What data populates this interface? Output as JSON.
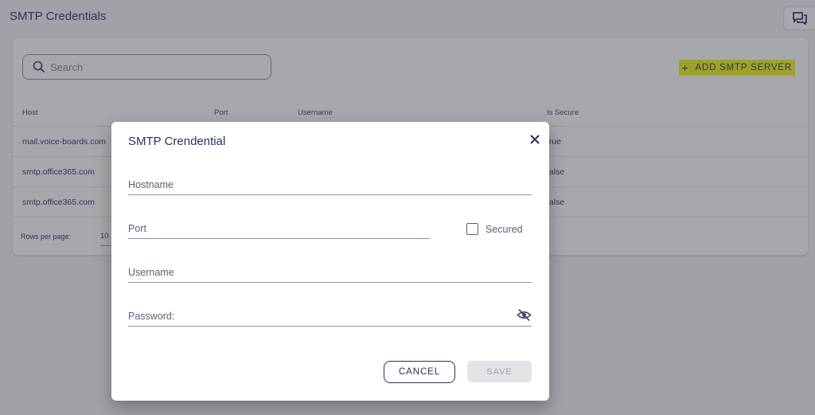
{
  "page": {
    "title": "SMTP Credentials"
  },
  "icons": {
    "chat": "chat-bubbles-icon",
    "search": "search-icon",
    "close": "close-icon",
    "password_toggle": "eye-off-icon"
  },
  "colors": {
    "primary": "#2d2f5a",
    "highlight": "#f2f20f",
    "disabled_bg": "#e3e4e7",
    "overlay": "rgba(60,62,70,0.45)"
  },
  "search": {
    "placeholder": "Search"
  },
  "toolbar": {
    "add_icon": "+",
    "add_label": "ADD SMTP SERVER"
  },
  "table": {
    "columns": [
      "Host",
      "Port",
      "Username",
      "Is Secure"
    ],
    "rows": [
      {
        "host": "mail.voice-boards.com",
        "secure": "true"
      },
      {
        "host": "smtp.office365.com",
        "secure": "false"
      },
      {
        "host": "smtp.office365.com",
        "secure": "false"
      }
    ],
    "footer": {
      "rows_per_page_label": "Rows per page:",
      "rows_per_page_value": "10"
    }
  },
  "dialog": {
    "title": "SMTP Crendential",
    "fields": {
      "hostname": "Hostname",
      "port": "Port",
      "secured": "Secured",
      "username": "Username",
      "password": "Password:"
    },
    "secured_checked": false,
    "cancel_label": "CANCEL",
    "save_label": "SAVE"
  }
}
